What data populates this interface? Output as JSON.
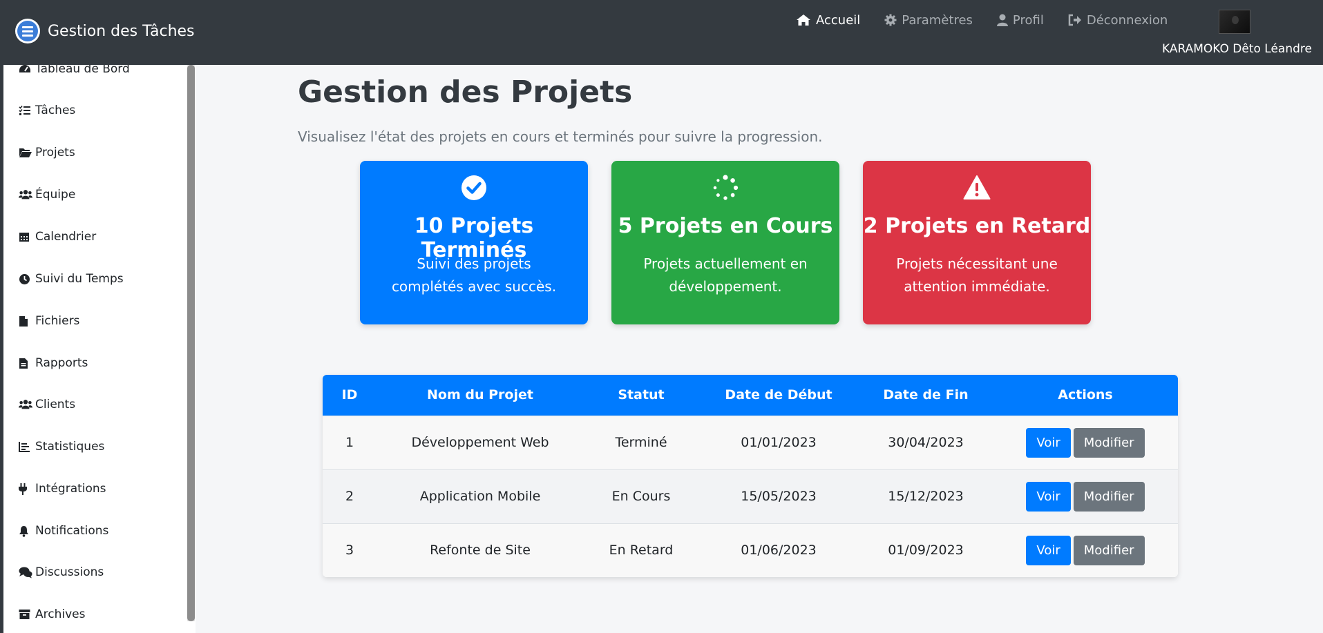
{
  "brand": {
    "title": "Gestion des Tâches"
  },
  "nav": {
    "links": [
      {
        "label": "Accueil",
        "icon": "home-icon",
        "active": true
      },
      {
        "label": "Paramètres",
        "icon": "gear-icon",
        "active": false
      },
      {
        "label": "Profil",
        "icon": "user-icon",
        "active": false
      },
      {
        "label": "Déconnexion",
        "icon": "sign-out-icon",
        "active": false
      }
    ],
    "user_name": "KARAMOKO Dêto Léandre"
  },
  "sidebar": {
    "items": [
      {
        "label": "Tableau de Bord",
        "icon": "dashboard-icon"
      },
      {
        "label": "Tâches",
        "icon": "tasks-icon"
      },
      {
        "label": "Projets",
        "icon": "folder-open-icon"
      },
      {
        "label": "Équipe",
        "icon": "users-icon"
      },
      {
        "label": "Calendrier",
        "icon": "calendar-icon"
      },
      {
        "label": "Suivi du Temps",
        "icon": "clock-icon"
      },
      {
        "label": "Fichiers",
        "icon": "file-icon"
      },
      {
        "label": "Rapports",
        "icon": "report-icon"
      },
      {
        "label": "Clients",
        "icon": "clients-icon"
      },
      {
        "label": "Statistiques",
        "icon": "chart-icon"
      },
      {
        "label": "Intégrations",
        "icon": "plug-icon"
      },
      {
        "label": "Notifications",
        "icon": "bell-icon"
      },
      {
        "label": "Discussions",
        "icon": "comments-icon"
      },
      {
        "label": "Archives",
        "icon": "archive-icon"
      }
    ]
  },
  "main": {
    "title": "Gestion des Projets",
    "subtitle": "Visualisez l'état des projets en cours et terminés pour suivre la progression.",
    "cards": [
      {
        "title": "10 Projets Terminés",
        "text": "Suivi des projets complétés avec succès.",
        "icon": "check-circle-icon",
        "color": "#007bff"
      },
      {
        "title": "5 Projets en Cours",
        "text": "Projets actuellement en développement.",
        "icon": "spinner-icon",
        "color": "#28a745"
      },
      {
        "title": "2 Projets en Retard",
        "text": "Projets nécessitant une attention immédiate.",
        "icon": "warning-icon",
        "color": "#dc3545"
      }
    ],
    "table": {
      "headers": [
        "ID",
        "Nom du Projet",
        "Statut",
        "Date de Début",
        "Date de Fin",
        "Actions"
      ],
      "rows": [
        {
          "id": "1",
          "name": "Développement Web",
          "status": "Terminé",
          "start": "01/01/2023",
          "end": "30/04/2023"
        },
        {
          "id": "2",
          "name": "Application Mobile",
          "status": "En Cours",
          "start": "15/05/2023",
          "end": "15/12/2023"
        },
        {
          "id": "3",
          "name": "Refonte de Site",
          "status": "En Retard",
          "start": "01/06/2023",
          "end": "01/09/2023"
        }
      ],
      "view_label": "Voir",
      "edit_label": "Modifier"
    }
  }
}
